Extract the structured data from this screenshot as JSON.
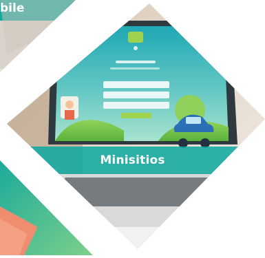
{
  "tiles": {
    "left_top": {
      "caption": "bile"
    },
    "center": {
      "caption": "Minisitios"
    }
  },
  "colors": {
    "teal_banner": "#12a9a0",
    "green_gradient_start": "#1cb59a",
    "green_gradient_end": "#7fd18a",
    "desk_white": "#f4f4f4",
    "laptop_dark": "#2f3940"
  }
}
